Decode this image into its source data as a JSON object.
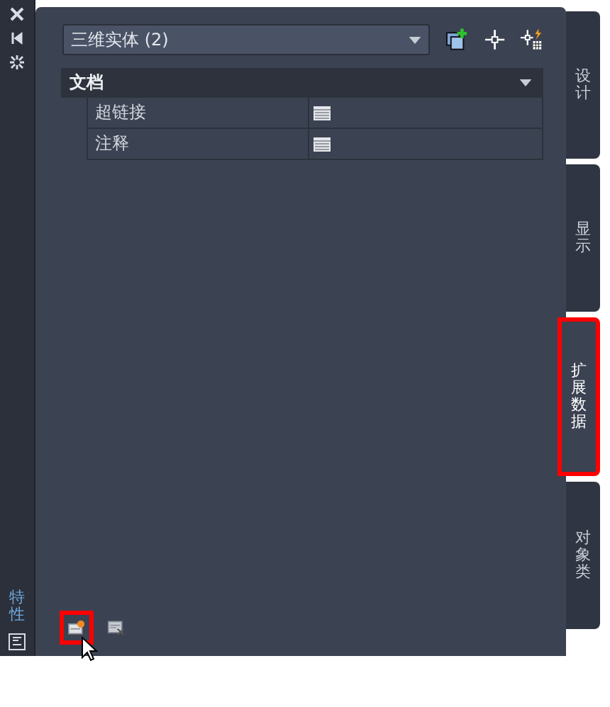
{
  "sidebar": {
    "title": "特性"
  },
  "selector": {
    "value": "三维实体 (2)"
  },
  "section": {
    "title": "文档",
    "expanded": true,
    "rows": [
      {
        "label": "超链接"
      },
      {
        "label": "注释"
      }
    ]
  },
  "bottom_buttons": [
    {
      "kind": "add",
      "highlighted": true
    },
    {
      "kind": "remove",
      "highlighted": false
    }
  ],
  "tabs": [
    {
      "label": "设计",
      "selected": false
    },
    {
      "label": "显示",
      "selected": false
    },
    {
      "label": "扩展数据",
      "selected": true
    },
    {
      "label": "对象类",
      "selected": false
    }
  ]
}
